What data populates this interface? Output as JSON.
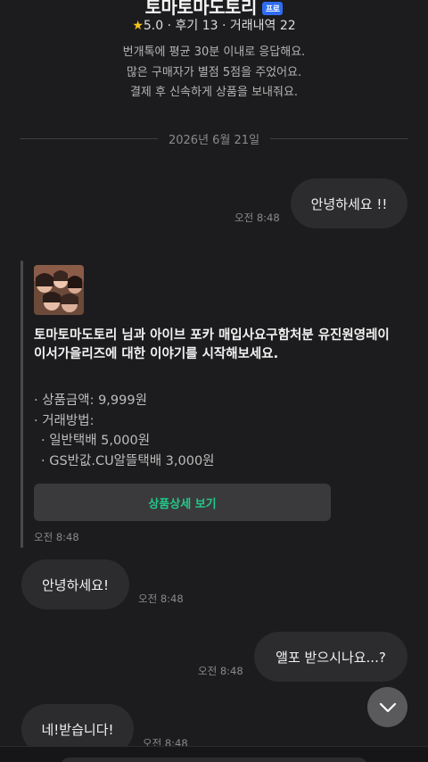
{
  "seller": {
    "name": "토마토마도토리",
    "badge": "프로",
    "rating": "5.0",
    "reviews": "후기 13",
    "trades": "거래내역 22",
    "info_lines": [
      "번개톡에 평균 30분 이내로 응답해요.",
      "많은 구매자가 별점 5점을 주었어요.",
      "결제 후 신속하게 상품을 보내줘요."
    ]
  },
  "chat": {
    "date_divider": "2026년 6월 21일",
    "messages": [
      {
        "side": "right",
        "text": "안녕하세요 !!",
        "time": "오전 8:48"
      },
      {
        "side": "left",
        "text": "안녕하세요!",
        "time": "오전 8:48"
      },
      {
        "side": "right",
        "text": "앨포 받으시나요...?",
        "time": "오전 8:48"
      },
      {
        "side": "left",
        "text": "네!받습니다!",
        "time": "오전 8:48"
      }
    ]
  },
  "product_card": {
    "title": "토마토마도토리 님과 아이브 포카 매입사요구함처분 유진원영레이이서가을리즈에 대한 이야기를 시작해보세요.",
    "price": "· 상품금액: 9,999원",
    "method_label": "· 거래방법:",
    "methods": [
      "· 일반택배 5,000원",
      "· GS반값.CU알뜰택배 3,000원"
    ],
    "button_label": "상품상세 보기",
    "time": "오전 8:48"
  },
  "icons": {
    "star": "star-icon",
    "scroll_down": "chevron-down-icon"
  },
  "colors": {
    "background": "#1c1c1e",
    "bubble": "#2c2c2e",
    "accent_green": "#22c88a",
    "badge_blue": "#2f6df0",
    "star": "#f5c518"
  }
}
